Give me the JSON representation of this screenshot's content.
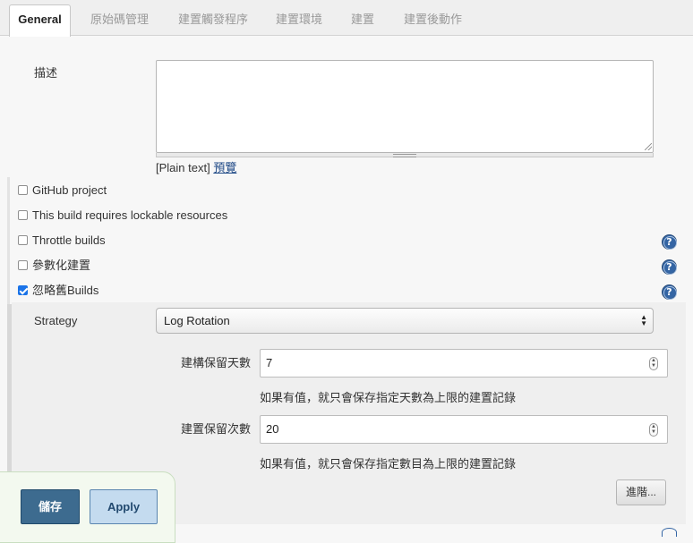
{
  "tabs": [
    {
      "label": "General",
      "active": true
    },
    {
      "label": "原始碼管理"
    },
    {
      "label": "建置觸發程序"
    },
    {
      "label": "建置環境"
    },
    {
      "label": "建置"
    },
    {
      "label": "建置後動作"
    }
  ],
  "description": {
    "label": "描述",
    "value": "",
    "format_note": "[Plain text]",
    "preview_link": "預覽"
  },
  "options": [
    {
      "label": "GitHub project",
      "checked": false,
      "help": false
    },
    {
      "label": "This build requires lockable resources",
      "checked": false,
      "help": false
    },
    {
      "label": "Throttle builds",
      "checked": false,
      "help": true
    },
    {
      "label": "參數化建置",
      "checked": false,
      "help": true
    },
    {
      "label": "忽略舊Builds",
      "checked": true,
      "help": true
    }
  ],
  "discard_builds": {
    "strategy_label": "Strategy",
    "strategy_value": "Log Rotation",
    "days_label": "建構保留天數",
    "days_value": "7",
    "days_hint": "如果有值，就只會保存指定天數為上限的建置記錄",
    "count_label": "建置保留次數",
    "count_value": "20",
    "count_hint": "如果有值，就只會保存指定數目為上限的建置記錄",
    "advanced_button": "進階..."
  },
  "help_icon_glyph": "?",
  "footer": {
    "save_button": "儲存",
    "apply_button": "Apply"
  }
}
